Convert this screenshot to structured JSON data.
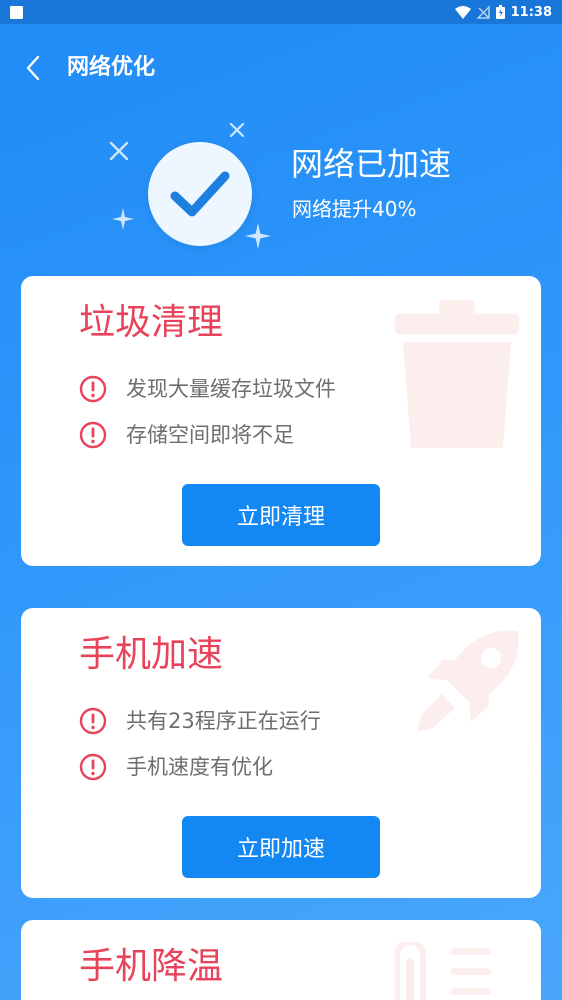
{
  "status_bar": {
    "time": "11:38"
  },
  "header": {
    "title": "网络优化"
  },
  "hero": {
    "title": "网络已加速",
    "subtitle": "网络提升40%"
  },
  "cards": [
    {
      "title": "垃圾清理",
      "items": [
        "发现大量缓存垃圾文件",
        "存储空间即将不足"
      ],
      "button": "立即清理",
      "bg_icon": "trash-icon"
    },
    {
      "title": "手机加速",
      "items": [
        "共有23程序正在运行",
        "手机速度有优化"
      ],
      "button": "立即加速",
      "bg_icon": "rocket-icon"
    },
    {
      "title": "手机降温",
      "items": [],
      "button": "",
      "bg_icon": "thermometer-icon"
    }
  ],
  "colors": {
    "accent_red": "#e8435a",
    "button_blue": "#1388f3",
    "background_blue": "#2f97fb"
  }
}
